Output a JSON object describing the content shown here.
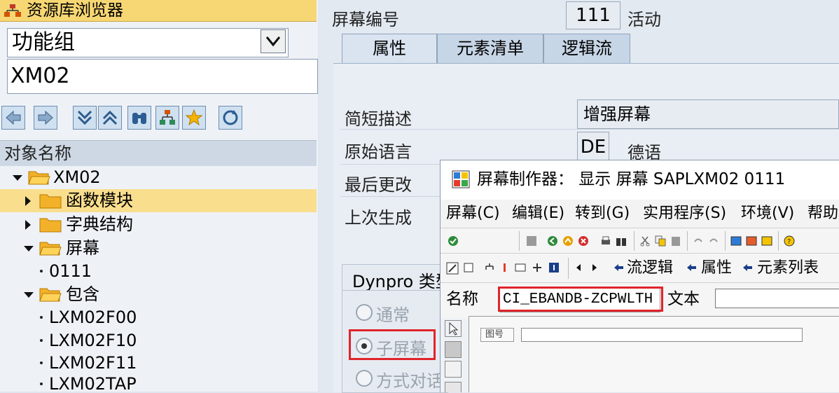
{
  "left_pane": {
    "title": "资源库浏览器",
    "object_type": "功能组",
    "object_name": "XM02",
    "tree_header": "对象名称",
    "tree": [
      {
        "label": "XM02",
        "kind": "folder-open"
      },
      {
        "label": "函数模块",
        "kind": "folder-closed",
        "selected": true
      },
      {
        "label": "字典结构",
        "kind": "folder-closed"
      },
      {
        "label": "屏幕",
        "kind": "folder-open"
      },
      {
        "label": "0111",
        "kind": "leaf"
      },
      {
        "label": "包含",
        "kind": "folder-open"
      },
      {
        "label": "LXM02F00",
        "kind": "leaf"
      },
      {
        "label": "LXM02F10",
        "kind": "leaf"
      },
      {
        "label": "LXM02F11",
        "kind": "leaf"
      },
      {
        "label": "LXM02TAP",
        "kind": "leaf"
      }
    ],
    "toolbar_icons": [
      "back-icon",
      "forward-icon",
      "collapse-icon",
      "expand-icon",
      "binoculars-icon",
      "hierarchy-icon",
      "favorite-icon",
      "refresh-icon"
    ]
  },
  "main": {
    "screen_number_label": "屏幕编号",
    "screen_number": "111",
    "status": "活动",
    "tabs": [
      "属性",
      "元素清单",
      "逻辑流"
    ],
    "fields": {
      "short_desc_label": "简短描述",
      "short_desc_value": "增强屏幕",
      "orig_lang_label": "原始语言",
      "orig_lang_code": "DE",
      "orig_lang_name": "德语",
      "last_changed_label": "最后更改",
      "last_generated_label": "上次生成"
    },
    "dynpro_group_label": "Dynpro 类型",
    "dynpro_options": [
      "通常",
      "子屏幕",
      "方式对话"
    ],
    "dynpro_selected": "子屏幕"
  },
  "popup": {
    "title": "屏幕制作器：  显示 屏幕 SAPLXM02 0111",
    "menu": [
      "屏幕(C)",
      "编辑(E)",
      "转到(G)",
      "实用程序(S)",
      "环境(V)",
      "帮助"
    ],
    "nav_links": [
      "流逻辑",
      "属性",
      "元素列表"
    ],
    "name_label": "名称",
    "name_value": "CI_EBANDB-ZCPWLTH",
    "text_label": "文本",
    "canvas_label": "图号"
  },
  "colors": {
    "title_bar": "#f7d774",
    "selection": "#f9de8e",
    "highlight_border": "#e0242a",
    "tab_active": "#d9e4f0"
  }
}
